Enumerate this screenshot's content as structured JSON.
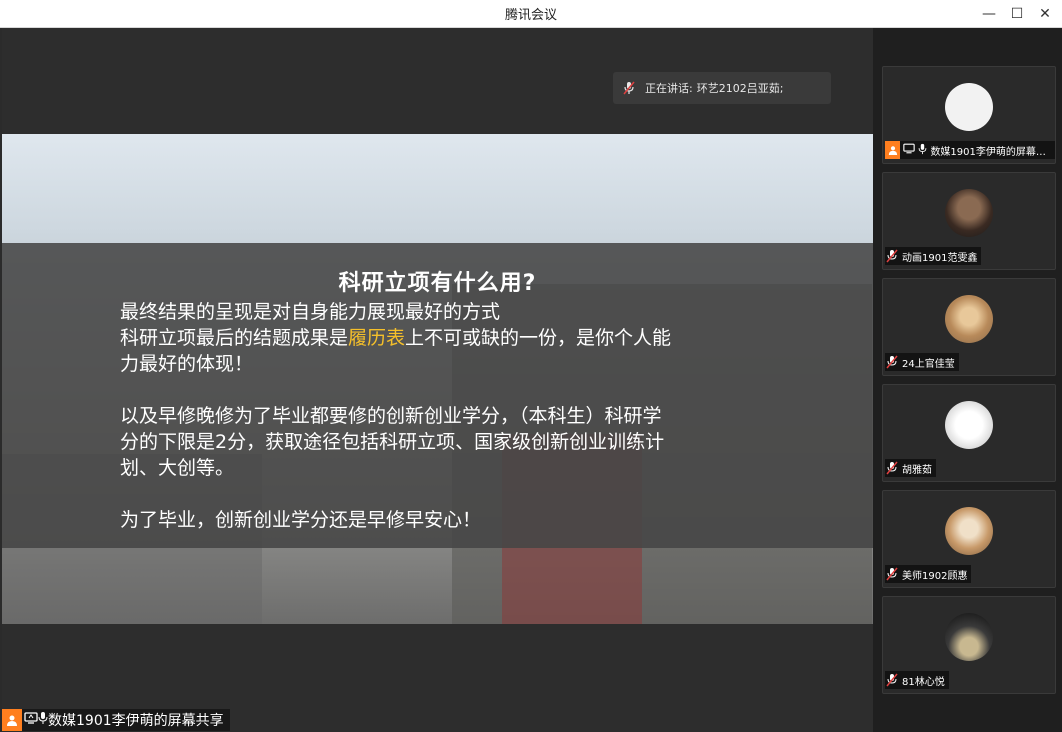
{
  "window": {
    "title": "腾讯会议",
    "minimize": "—",
    "maximize": "☐",
    "close": "✕"
  },
  "speaking": {
    "prefix": "正在讲话:",
    "name": "环艺2102吕亚茹;"
  },
  "slide": {
    "title": "科研立项有什么用?",
    "line1": "最终结果的呈现是对自身能力展现最好的方式",
    "line2_a": "科研立项最后的结题成果是",
    "line2_highlight": "履历表",
    "line2_b": "上不可或缺的一份，是你个人能",
    "line3": "力最好的体现！",
    "line4": "以及早修晚修为了毕业都要修的创新创业学分，（本科生）科研学",
    "line5": "分的下限是2分，获取途径包括科研立项、国家级创新创业训练计",
    "line6": "划、大创等。",
    "line7": "为了毕业，创新创业学分还是早修早安心！",
    "highlight_color": "#f6c02a"
  },
  "share_label": {
    "text": "数媒1901李伊萌的屏幕共享"
  },
  "participants": [
    {
      "name": "数媒1901李伊萌的屏幕共..."
    },
    {
      "name": "动画1901范雯鑫"
    },
    {
      "name": "24上官佳莹"
    },
    {
      "name": "胡雅茹"
    },
    {
      "name": "美师1902顾惠"
    },
    {
      "name": "81林心悦"
    }
  ],
  "colors": {
    "accent": "#ff7f1f",
    "mic_off": "#e04040"
  }
}
